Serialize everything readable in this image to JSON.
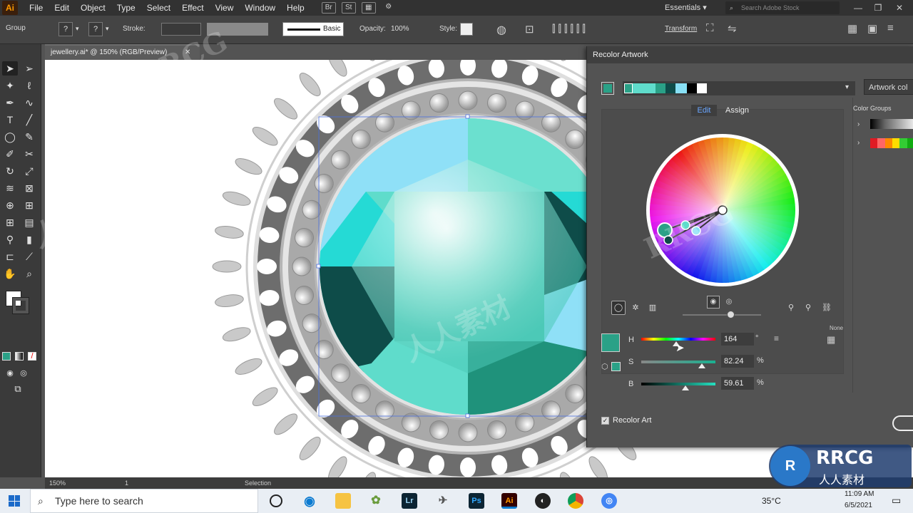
{
  "app": {
    "logo": "Ai"
  },
  "menu": [
    "File",
    "Edit",
    "Object",
    "Type",
    "Select",
    "Effect",
    "View",
    "Window",
    "Help"
  ],
  "workspace": "Essentials",
  "search_placeholder": "Search Adobe Stock",
  "control_bar": {
    "selection_type": "Group",
    "stroke_label": "Stroke:",
    "brush_label": "Basic",
    "opacity_label": "Opacity:",
    "opacity_value": "100%",
    "style_label": "Style:",
    "transform_label": "Transform"
  },
  "document_tab": "jewellery.ai* @ 150% (RGB/Preview)",
  "status_bar": {
    "zoom": "150%",
    "page": "1",
    "tool": "Selection"
  },
  "recolor": {
    "title": "Recolor Artwork",
    "artwork_colors_label": "Artwork col",
    "tabs": [
      "Edit",
      "Assign"
    ],
    "active_tab": "Edit",
    "color_groups_label": "Color Groups",
    "none_label": "None",
    "h_label": "H",
    "h_value": "164",
    "h_unit": "°",
    "s_label": "S",
    "s_value": "82.24",
    "s_unit": "%",
    "b_label": "B",
    "b_value": "59.61",
    "b_unit": "%",
    "recolor_art_label": "Recolor Art",
    "recolor_art_checked": true,
    "base_color": "#2aa187",
    "strip_colors": [
      "#2aa187",
      "#5fdccb",
      "#2aa187",
      "#0e4c49",
      "#88e0f5",
      "#000000",
      "#ffffff"
    ]
  },
  "taskbar": {
    "search_placeholder": "Type here to search",
    "apps": [
      "Lr",
      "Ps",
      "Ai"
    ],
    "temperature": "35°C",
    "time": "11:09 AM",
    "date": "6/5/2021"
  },
  "watermark": {
    "text1": "RRCG",
    "text2": "人人素材"
  }
}
